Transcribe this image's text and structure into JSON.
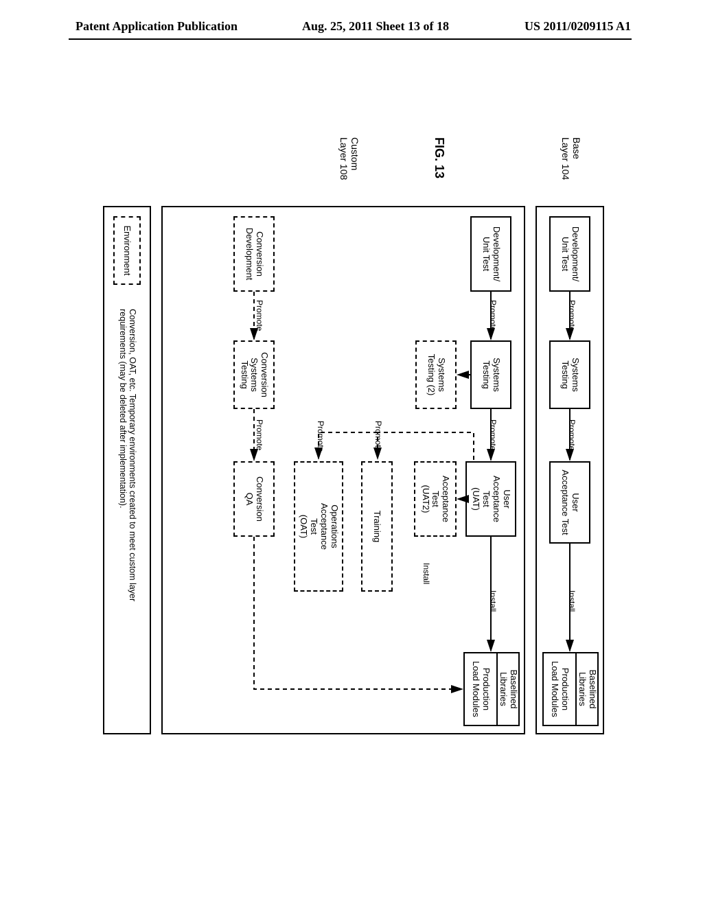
{
  "header": {
    "left": "Patent Application Publication",
    "center": "Aug. 25, 2011  Sheet 13 of 18",
    "right": "US 2011/0209115 A1"
  },
  "figure_label": "FIG. 13",
  "layers": {
    "base": "Base\nLayer 104",
    "custom": "Custom\nLayer 108"
  },
  "boxes": {
    "base_dev": "Development/\nUnit Test",
    "base_sys": "Systems\nTesting",
    "base_uat": "User\nAcceptance Test",
    "base_lib": "Baselined\nLibraries",
    "base_prod": "Production\nLoad Modules",
    "cust_dev": "Development/\nUnit Test",
    "cust_sys": "Systems\nTesting",
    "cust_sys2": "Systems\nTesting (2)",
    "cust_uat": "User\nAcceptance\nTest\n(UAT)",
    "cust_uat2": "Acceptance\nTest\n(UAT2)",
    "cust_training": "Training",
    "cust_oat": "Operations\nAcceptance\nTest\n(OAT)",
    "cust_lib": "Baselined\nLibraries",
    "cust_prod": "Production\nLoad Modules",
    "conv_dev": "Conversion\nDevelopment",
    "conv_sys": "Conversion\nSystems\nTesting",
    "conv_qa": "Conversion\nQA"
  },
  "edge_labels": {
    "promote": "Promote",
    "install": "Install"
  },
  "legend": {
    "env": "Environment",
    "note": "Conversion, OAT, etc. Temporary environments created to meet custom layer\nrequirements (may be deleted after implementation)."
  },
  "chart_data": {
    "type": "diagram",
    "title": "FIG. 13",
    "lanes": [
      {
        "id": "base",
        "label": "Base Layer 104"
      },
      {
        "id": "custom",
        "label": "Custom Layer 108"
      }
    ],
    "nodes": [
      {
        "id": "b_dev",
        "lane": "base",
        "label": "Development / Unit Test",
        "style": "solid"
      },
      {
        "id": "b_sys",
        "lane": "base",
        "label": "Systems Testing",
        "style": "solid"
      },
      {
        "id": "b_uat",
        "lane": "base",
        "label": "User Acceptance Test",
        "style": "solid"
      },
      {
        "id": "b_lib",
        "lane": "base",
        "label": "Baselined Libraries",
        "style": "solid"
      },
      {
        "id": "b_prod",
        "lane": "base",
        "label": "Production Load Modules",
        "style": "solid"
      },
      {
        "id": "c_dev",
        "lane": "custom",
        "label": "Development / Unit Test",
        "style": "solid"
      },
      {
        "id": "c_sys",
        "lane": "custom",
        "label": "Systems Testing",
        "style": "solid"
      },
      {
        "id": "c_sys2",
        "lane": "custom",
        "label": "Systems Testing (2)",
        "style": "dashed"
      },
      {
        "id": "c_uat",
        "lane": "custom",
        "label": "User Acceptance Test (UAT)",
        "style": "solid"
      },
      {
        "id": "c_uat2",
        "lane": "custom",
        "label": "Acceptance Test (UAT2)",
        "style": "dashed"
      },
      {
        "id": "c_train",
        "lane": "custom",
        "label": "Training",
        "style": "dashed"
      },
      {
        "id": "c_oat",
        "lane": "custom",
        "label": "Operations Acceptance Test (OAT)",
        "style": "dashed"
      },
      {
        "id": "c_lib",
        "lane": "custom",
        "label": "Baselined Libraries",
        "style": "solid"
      },
      {
        "id": "c_prod",
        "lane": "custom",
        "label": "Production Load Modules",
        "style": "solid"
      },
      {
        "id": "cv_dev",
        "lane": "custom",
        "label": "Conversion Development",
        "style": "dashed"
      },
      {
        "id": "cv_sys",
        "lane": "custom",
        "label": "Conversion Systems Testing",
        "style": "dashed"
      },
      {
        "id": "cv_qa",
        "lane": "custom",
        "label": "Conversion QA",
        "style": "dashed"
      }
    ],
    "edges": [
      {
        "from": "b_dev",
        "to": "b_sys",
        "label": "Promote",
        "style": "solid"
      },
      {
        "from": "b_sys",
        "to": "b_uat",
        "label": "Promote",
        "style": "solid"
      },
      {
        "from": "b_uat",
        "to": "b_lib",
        "label": "Install",
        "style": "solid"
      },
      {
        "from": "b_lib",
        "to": "b_prod",
        "label": "",
        "style": "solid"
      },
      {
        "from": "c_dev",
        "to": "c_sys",
        "label": "Promote",
        "style": "solid"
      },
      {
        "from": "c_sys",
        "to": "c_uat",
        "label": "Promote",
        "style": "solid"
      },
      {
        "from": "c_uat",
        "to": "c_lib",
        "label": "Install",
        "style": "solid"
      },
      {
        "from": "c_lib",
        "to": "c_prod",
        "label": "",
        "style": "solid"
      },
      {
        "from": "c_sys",
        "to": "c_sys2",
        "label": "",
        "style": "dashed"
      },
      {
        "from": "c_uat",
        "to": "c_uat2",
        "label": "",
        "style": "dashed"
      },
      {
        "from": "c_uat",
        "to": "c_train",
        "label": "Promote",
        "style": "dashed"
      },
      {
        "from": "c_uat",
        "to": "c_oat",
        "label": "Promote",
        "style": "dashed"
      },
      {
        "from": "cv_dev",
        "to": "cv_sys",
        "label": "Promote",
        "style": "dashed"
      },
      {
        "from": "cv_sys",
        "to": "cv_qa",
        "label": "Promote",
        "style": "dashed"
      },
      {
        "from": "cv_qa",
        "to": "c_prod",
        "label": "Install",
        "style": "dashed"
      }
    ],
    "legend": {
      "dashed_box": "Environment",
      "note": "Conversion, OAT, etc. Temporary environments created to meet custom layer requirements (may be deleted after implementation)."
    }
  }
}
